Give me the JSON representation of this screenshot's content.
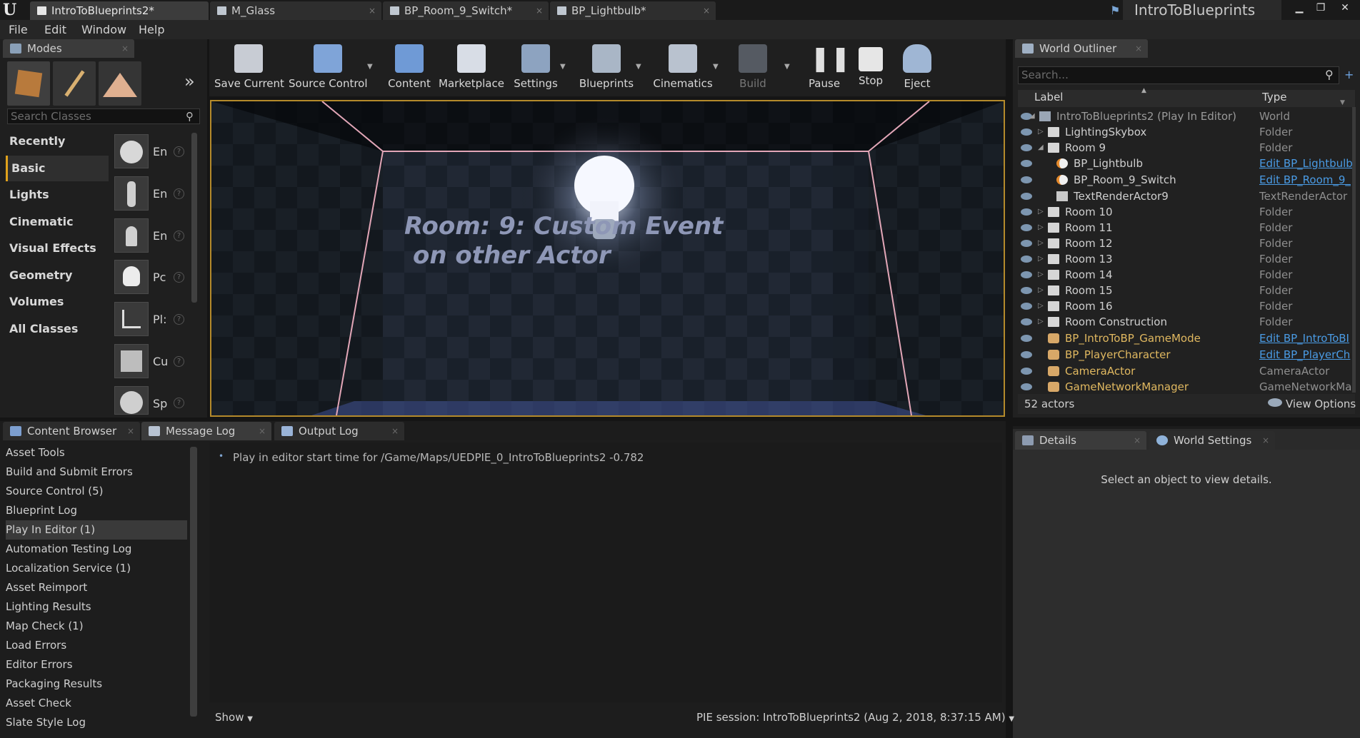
{
  "title_bar": {
    "tabs": [
      {
        "label": "IntroToBlueprints2*"
      },
      {
        "label": "M_Glass"
      },
      {
        "label": "BP_Room_9_Switch*"
      },
      {
        "label": "BP_Lightbulb*"
      }
    ],
    "project_name": "IntroToBlueprints"
  },
  "menu": [
    "File",
    "Edit",
    "Window",
    "Help"
  ],
  "modes": {
    "tab_label": "Modes",
    "search_placeholder": "Search Classes",
    "categories": [
      "Recently Placed",
      "Basic",
      "Lights",
      "Cinematic",
      "Visual Effects",
      "Geometry",
      "Volumes",
      "All Classes"
    ],
    "selected_category": "Basic",
    "placeables": [
      "En",
      "En",
      "En",
      "Pc",
      "Pl:",
      "Cu",
      "Sp"
    ]
  },
  "toolbar": {
    "buttons": [
      "Save Current",
      "Source Control",
      "Content",
      "Marketplace",
      "Settings",
      "Blueprints",
      "Cinematics",
      "Build",
      "Pause",
      "Stop",
      "Eject"
    ]
  },
  "viewport": {
    "line1": "Room: 9: Custom Event",
    "line2": "on other Actor"
  },
  "outliner": {
    "tab_label": "World Outliner",
    "search_placeholder": "Search...",
    "col_label": "Label",
    "col_type": "Type",
    "rows": [
      {
        "label": "IntroToBlueprints2 (Play In Editor)",
        "type": "World"
      },
      {
        "label": "LightingSkybox",
        "type": "Folder"
      },
      {
        "label": "Room 9",
        "type": "Folder"
      },
      {
        "label": "BP_Lightbulb",
        "type": "Edit BP_Lightbulb"
      },
      {
        "label": "BP_Room_9_Switch",
        "type": "Edit BP_Room_9_"
      },
      {
        "label": "TextRenderActor9",
        "type": "TextRenderActor"
      },
      {
        "label": "Room 10",
        "type": "Folder"
      },
      {
        "label": "Room 11",
        "type": "Folder"
      },
      {
        "label": "Room 12",
        "type": "Folder"
      },
      {
        "label": "Room 13",
        "type": "Folder"
      },
      {
        "label": "Room 14",
        "type": "Folder"
      },
      {
        "label": "Room 15",
        "type": "Folder"
      },
      {
        "label": "Room 16",
        "type": "Folder"
      },
      {
        "label": "Room Construction",
        "type": "Folder"
      },
      {
        "label": "BP_IntroToBP_GameMode",
        "type": "Edit BP_IntroToBI"
      },
      {
        "label": "BP_PlayerCharacter",
        "type": "Edit BP_PlayerCh"
      },
      {
        "label": "CameraActor",
        "type": "CameraActor"
      },
      {
        "label": "GameNetworkManager",
        "type": "GameNetworkMan"
      }
    ],
    "actor_count": "52 actors",
    "view_options": "View Options"
  },
  "details": {
    "tab_details": "Details",
    "tab_world_settings": "World Settings",
    "empty_message": "Select an object to view details."
  },
  "bottom": {
    "tabs": [
      "Content Browser",
      "Message Log",
      "Output Log"
    ],
    "log_categories": [
      "Asset Tools",
      "Build and Submit Errors",
      "Source Control (5)",
      "Blueprint Log",
      "Play In Editor (1)",
      "Automation Testing Log",
      "Localization Service (1)",
      "Asset Reimport",
      "Lighting Results",
      "Map Check (1)",
      "Load Errors",
      "Editor Errors",
      "Packaging Results",
      "Asset Check",
      "Slate Style Log"
    ],
    "selected_category": "Play In Editor (1)",
    "message": "Play in editor start time for /Game/Maps/UEDPIE_0_IntroToBlueprints2 -0.782",
    "show_label": "Show",
    "session_label": "PIE session: IntroToBlueprints2 (Aug 2, 2018, 8:37:15 AM)"
  }
}
